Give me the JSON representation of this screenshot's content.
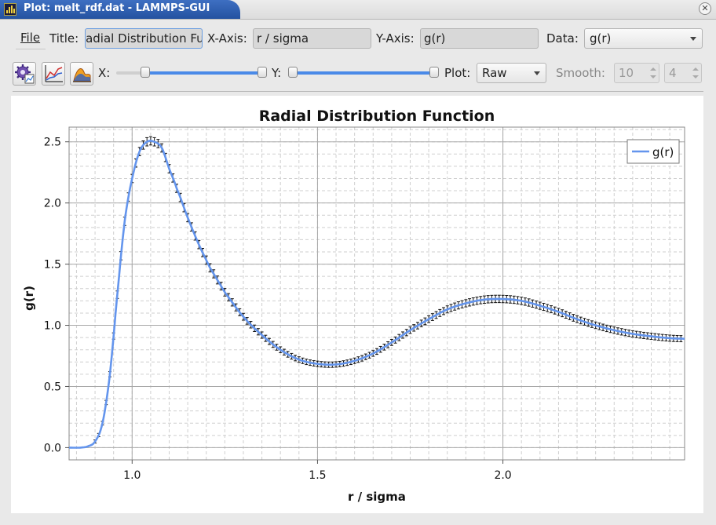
{
  "window": {
    "title": "Plot: melt_rdf.dat - LAMMPS-GUI"
  },
  "menu": {
    "file_label": "File"
  },
  "toolbar1": {
    "title_label": "Title:",
    "title_value": "Radial Distribution Function",
    "xaxis_label": "X-Axis:",
    "xaxis_value": "r / sigma",
    "yaxis_label": "Y-Axis:",
    "yaxis_value": "g(r)",
    "data_label": "Data:",
    "data_value": "g(r)"
  },
  "toolbar2": {
    "icons": [
      "settings-icon",
      "export-plot-icon",
      "export-image-icon"
    ],
    "x_label": "X:",
    "x_slider_min": 0.17,
    "x_slider_max": 1.0,
    "y_label": "Y:",
    "y_slider_min": 0.0,
    "y_slider_max": 1.0,
    "plot_label": "Plot:",
    "plot_value": "Raw",
    "smooth_label": "Smooth:",
    "smooth_window": "10",
    "smooth_order": "4"
  },
  "colors": {
    "accent": "#4a8ae8",
    "series": "#6495ed",
    "title_tab": "#2d5cab"
  },
  "chart_data": {
    "type": "line",
    "title": "Radial Distribution Function",
    "xlabel": "r / sigma",
    "ylabel": "g(r)",
    "xlim": [
      0.83,
      2.49
    ],
    "ylim": [
      -0.1,
      2.62
    ],
    "xticks": [
      "1.0",
      "1.5",
      "2.0"
    ],
    "yticks": [
      "0.0",
      "0.5",
      "1.0",
      "1.5",
      "2.0",
      "2.5"
    ],
    "grid": true,
    "legend": "top-right",
    "error_bars": true,
    "series": [
      {
        "name": "g(r)",
        "x": [
          0.83,
          0.86,
          0.88,
          0.9,
          0.92,
          0.94,
          0.96,
          0.98,
          1.0,
          1.02,
          1.04,
          1.06,
          1.08,
          1.1,
          1.12,
          1.15,
          1.18,
          1.21,
          1.25,
          1.3,
          1.35,
          1.4,
          1.45,
          1.5,
          1.55,
          1.6,
          1.65,
          1.7,
          1.75,
          1.8,
          1.85,
          1.9,
          1.95,
          2.0,
          2.05,
          2.1,
          2.15,
          2.2,
          2.25,
          2.3,
          2.35,
          2.4,
          2.45,
          2.49
        ],
        "y": [
          0.0,
          0.0,
          0.01,
          0.05,
          0.2,
          0.6,
          1.25,
          1.85,
          2.2,
          2.42,
          2.5,
          2.5,
          2.45,
          2.28,
          2.12,
          1.88,
          1.66,
          1.47,
          1.27,
          1.07,
          0.92,
          0.8,
          0.72,
          0.685,
          0.68,
          0.71,
          0.77,
          0.86,
          0.96,
          1.05,
          1.13,
          1.18,
          1.21,
          1.215,
          1.2,
          1.16,
          1.11,
          1.05,
          1.0,
          0.96,
          0.93,
          0.91,
          0.895,
          0.89
        ]
      }
    ]
  }
}
